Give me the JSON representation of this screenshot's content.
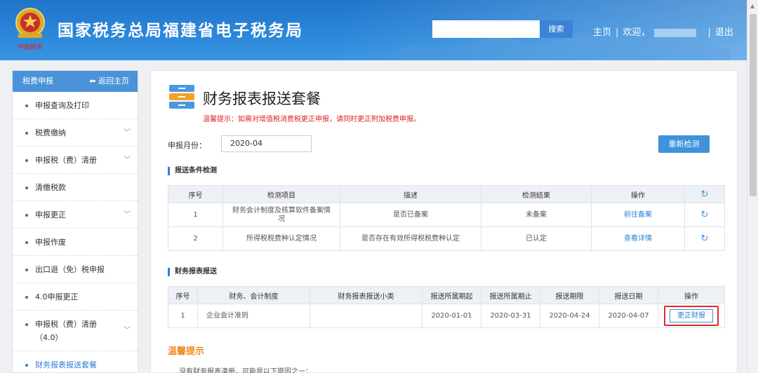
{
  "header": {
    "site_title": "国家税务总局福建省电子税务局",
    "search_placeholder": "",
    "search_button": "搜索",
    "nav": {
      "home": "主页",
      "welcome": "欢迎，",
      "logout": "退出"
    }
  },
  "sidebar": {
    "heading": "税费申报",
    "back_home": "返回主页",
    "items": [
      {
        "label": "申报查询及打印",
        "has_submenu": false
      },
      {
        "label": "税费缴纳",
        "has_submenu": true
      },
      {
        "label": "申报税（费）清册",
        "has_submenu": true
      },
      {
        "label": "清缴税款",
        "has_submenu": false
      },
      {
        "label": "申报更正",
        "has_submenu": true
      },
      {
        "label": "申报作废",
        "has_submenu": false
      },
      {
        "label": "出口退（免）税申报",
        "has_submenu": false
      },
      {
        "label": "4.0申报更正",
        "has_submenu": false
      },
      {
        "label_line1": "申报税（费）清册",
        "label_line2": "（4.0）",
        "has_submenu": true
      },
      {
        "label": "财务报表报送套餐",
        "active": true
      }
    ]
  },
  "main": {
    "title": "财务报表报送套餐",
    "warning": "温馨提示：如需对增值税消费税更正申报，请同时更正附加税费申报。",
    "period_label": "申报月份：",
    "period_value": "2020-04",
    "recheck_button": "重新检测",
    "check_section": {
      "title": "报送条件检测",
      "headers": [
        "序号",
        "检测项目",
        "描述",
        "检测结果",
        "操作"
      ],
      "rows": [
        {
          "no": "1",
          "item": "财务会计制度及核算软件备案情况",
          "desc": "是否已备案",
          "result": "未备案",
          "action": "前往备案"
        },
        {
          "no": "2",
          "item": "所得税税费种认定情况",
          "desc": "是否存在有效所得税税费种认定",
          "result": "已认定",
          "action": "查看详情"
        }
      ]
    },
    "report_section": {
      "title": "财务报表报送",
      "headers": [
        "序号",
        "财务、会计制度",
        "财务报表报送小类",
        "报送所属期起",
        "报送所属期止",
        "报送期限",
        "报送日期",
        "操作"
      ],
      "rows": [
        {
          "no": "1",
          "system": "企业会计准则",
          "subclass": "",
          "start": "2020-01-01",
          "end": "2020-03-31",
          "deadline": "2020-04-24",
          "date": "2020-04-07",
          "action": "更正财报"
        }
      ]
    },
    "tips": {
      "title": "温馨提示",
      "text": "没有财务报表清册，可能是以下原因之一："
    }
  },
  "colors": {
    "header_blue": "#2b86d9",
    "accent": "#3d93dc",
    "warning_red": "#e02020",
    "tips_orange": "#f08a1c",
    "highlight_red": "#e3292e"
  }
}
